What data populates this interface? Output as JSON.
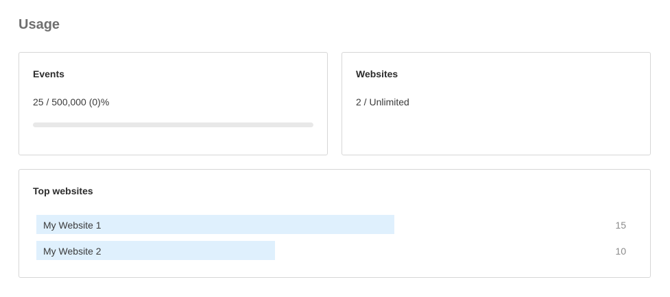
{
  "page": {
    "title": "Usage"
  },
  "events_card": {
    "title": "Events",
    "value_text": "25 / 500,000 (0)%",
    "progress_fraction": 5e-05,
    "progress_color": "#2680eb",
    "track_color": "#e8e8e8"
  },
  "websites_card": {
    "title": "Websites",
    "value_text": "2 / Unlimited"
  },
  "top_websites_card": {
    "title": "Top websites",
    "bar_color": "#dff0fd",
    "items": [
      {
        "name": "My Website 1",
        "count": "15",
        "value": 15
      },
      {
        "name": "My Website 2",
        "count": "10",
        "value": 10
      }
    ]
  }
}
